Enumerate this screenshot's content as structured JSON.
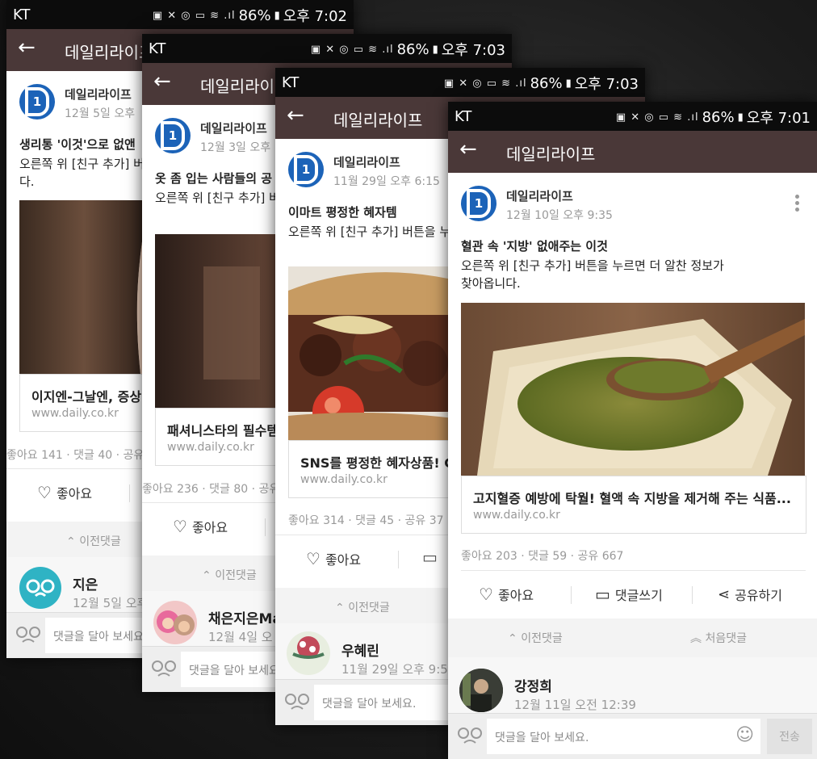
{
  "screens": [
    {
      "status": {
        "carrier": "KT",
        "battery": "86%",
        "time": "오후 7:02"
      },
      "appbar": {
        "title": "데일리라이프"
      },
      "post": {
        "author": "데일리라이프",
        "date": "12월 5일 오후",
        "headline": "생리통 '이것'으로 없앤",
        "body": "오른쪽 위 [친구 추가] 버튼을 누르면 더 알찬 정보가 찾아옵니다."
      },
      "card": {
        "title": "이지엔-그날엔, 증상",
        "url": "www.daily.co.kr"
      },
      "stats": "좋아요 141 · 댓글 40 · 공유",
      "actions": {
        "like": "좋아요"
      },
      "prev": "이전댓글",
      "comment": {
        "name": "지은",
        "date": "12월 5일 오후"
      },
      "input": {
        "placeholder": "댓글을 달아 보세요."
      }
    },
    {
      "status": {
        "carrier": "KT",
        "battery": "86%",
        "time": "오후 7:03"
      },
      "appbar": {
        "title": "데일리라이프"
      },
      "post": {
        "author": "데일리라이프",
        "date": "12월 3일 오후",
        "headline": "옷 좀 입는 사람들의 공",
        "body": "오른쪽 위 [친구 추가] 버튼을 누르면 더 알찬 정보가 찾아옵니다."
      },
      "card": {
        "title": "패셔니스타의 필수템",
        "url": "www.daily.co.kr"
      },
      "stats": "좋아요 236 · 댓글 80 · 공유",
      "actions": {
        "like": "좋아요"
      },
      "prev": "이전댓글",
      "comment": {
        "name": "채은지은Ma",
        "date": "12월 4일 오"
      },
      "input": {
        "placeholder": "댓글을 달아 보세요."
      }
    },
    {
      "status": {
        "carrier": "KT",
        "battery": "86%",
        "time": "오후 7:03"
      },
      "appbar": {
        "title": "데일리라이프"
      },
      "post": {
        "author": "데일리라이프",
        "date": "11월 29일 오후 6:15",
        "headline": "이마트 평정한 혜자템",
        "body": "오른쪽 위 [친구 추가] 버튼을 누르면 더 알찬 정보가 찾아옵니다."
      },
      "card": {
        "title": "SNS를 평정한 혜자상품! C",
        "url": "www.daily.co.kr"
      },
      "stats": "좋아요 314 · 댓글 45 · 공유 37",
      "actions": {
        "like": "좋아요"
      },
      "prev": "이전댓글",
      "comment": {
        "name": "우혜린",
        "date": "11월 29일 오후 9:5"
      },
      "input": {
        "placeholder": "댓글을 달아 보세요."
      }
    },
    {
      "status": {
        "carrier": "KT",
        "battery": "86%",
        "time": "오후 7:01"
      },
      "appbar": {
        "title": "데일리라이프"
      },
      "post": {
        "author": "데일리라이프",
        "date": "12월 10일 오후 9:35",
        "headline": "혈관 속 '지방' 없애주는 이것",
        "body": "오른쪽 위 [친구 추가] 버튼을 누르면 더 알찬 정보가 찾아옵니다."
      },
      "card": {
        "title": "고지혈증 예방에 탁월! 혈액 속 지방을 제거해 주는 식품...",
        "url": "www.daily.co.kr"
      },
      "stats": "좋아요 203 · 댓글 59 · 공유 667",
      "actions": {
        "like": "좋아요",
        "comment": "댓글쓰기",
        "share": "공유하기"
      },
      "prev": "이전댓글",
      "first": "처음댓글",
      "comment": {
        "name": "강정희",
        "date": "12월 11일 오전 12:39"
      },
      "input": {
        "placeholder": "댓글을 달아 보세요.",
        "send": "전송"
      }
    }
  ],
  "colors": {
    "appbar": "#4a3838",
    "logo": "#1c63b8",
    "statusbar": "#0c0c0c"
  },
  "icons": [
    "back-arrow-icon",
    "heart-icon",
    "comment-icon",
    "share-icon",
    "glasses-icon",
    "emoji-icon",
    "chevron-up-icon",
    "double-chevron-up-icon",
    "more-vert-icon"
  ]
}
